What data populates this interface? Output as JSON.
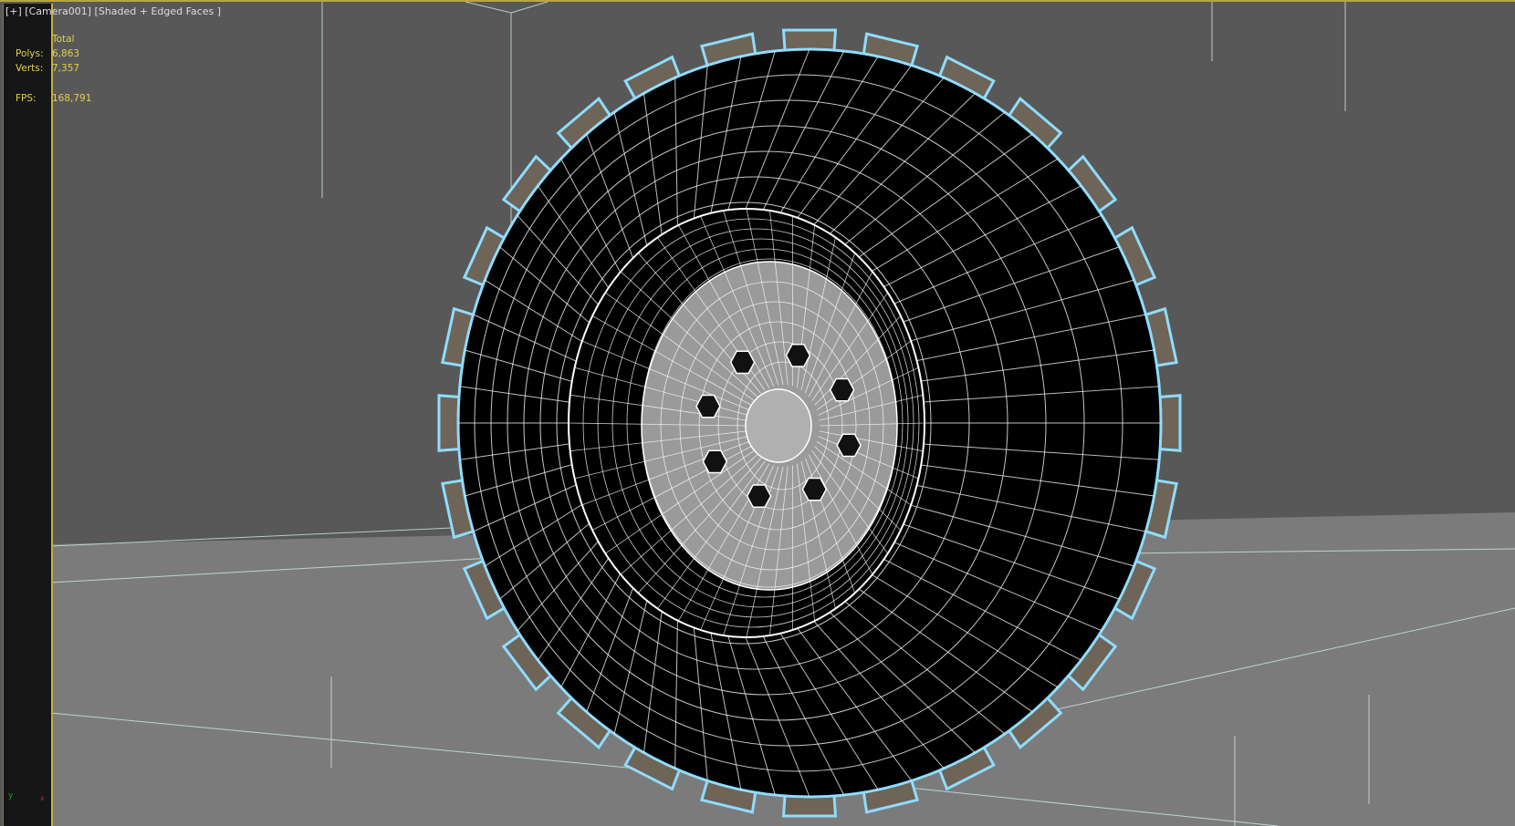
{
  "viewport": {
    "label": "[+] [Camera001] [Shaded + Edged Faces ]",
    "stats": {
      "header": "Total",
      "polys_label": "Polys:",
      "polys_value": "6,863",
      "verts_label": "Verts:",
      "verts_value": "7,357",
      "fps_label": "FPS:",
      "fps_value": "168,791"
    },
    "axis_gizmo": {
      "y_label": "y",
      "x_label": "x"
    }
  },
  "colors": {
    "accent": "#c2b040",
    "selection_glow": "#8fdcff",
    "background": "#585858",
    "floor": "#7b7b7b"
  }
}
